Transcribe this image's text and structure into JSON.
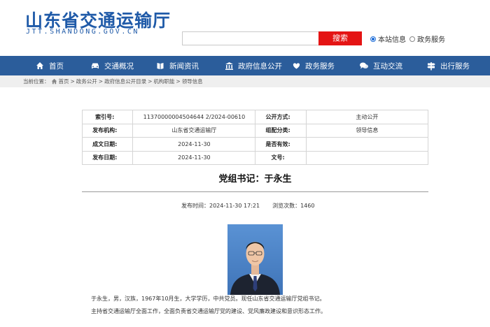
{
  "header": {
    "site_name": "山东省交通运输厅",
    "site_domain": "JTT.SHANDONG.GOV.CN",
    "search_button": "搜索",
    "scope_options": [
      {
        "label": "本站信息",
        "selected": true
      },
      {
        "label": "政务服务",
        "selected": false
      }
    ]
  },
  "nav": {
    "items": [
      {
        "label": "首页",
        "icon": "home-icon"
      },
      {
        "label": "交通概况",
        "icon": "car-icon"
      },
      {
        "label": "新闻资讯",
        "icon": "news-icon"
      },
      {
        "label": "政府信息公开",
        "icon": "building-icon"
      },
      {
        "label": "政务服务",
        "icon": "heart-hand-icon"
      },
      {
        "label": "互动交流",
        "icon": "chat-icon"
      },
      {
        "label": "出行服务",
        "icon": "signpost-icon"
      }
    ]
  },
  "breadcrumb": {
    "prefix": "当前位置：",
    "items": [
      "首页",
      "政务公开",
      "政府信息公开目录",
      "机构职能",
      "领导信息"
    ],
    "separator": ">"
  },
  "meta": {
    "rows": [
      {
        "k1": "索引号:",
        "v1": "11370000004504644 2/2024-00610",
        "k2": "公开方式:",
        "v2": "主动公开"
      },
      {
        "k1": "发布机构:",
        "v1": "山东省交通运输厅",
        "k2": "组配分类:",
        "v2": "领导信息"
      },
      {
        "k1": "成文日期:",
        "v1": "2024-11-30",
        "k2": "是否有效:",
        "v2": ""
      },
      {
        "k1": "发布日期:",
        "v1": "2024-11-30",
        "k2": "文号:",
        "v2": ""
      }
    ]
  },
  "article": {
    "title": "党组书记：于永生",
    "publish_label": "发布时间：2024-11-30 17:21",
    "views_label": "浏览次数：",
    "views": "1460",
    "bio_lines": [
      "于永生，男，汉族，1967年10月生，大学学历，中共党员。现任山东省交通运输厅党组书记。",
      "主持省交通运输厅全面工作，全面负责省交通运输厅党的建设、党风廉政建设和意识形态工作。"
    ]
  },
  "colors": {
    "brand": "#1f5aa8",
    "nav_bg": "#2b5d9b",
    "search_btn": "#e41414"
  }
}
